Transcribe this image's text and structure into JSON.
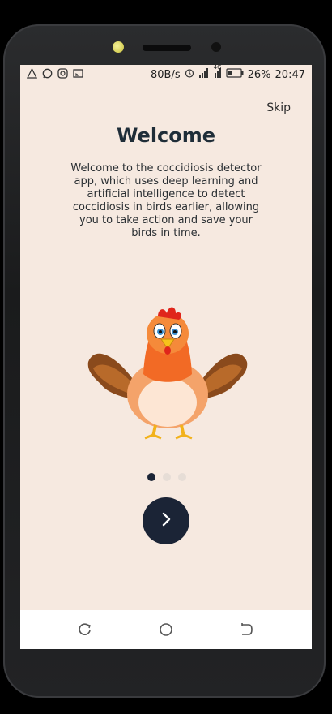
{
  "statusbar": {
    "speed": "80B/s",
    "battery": "26%",
    "time": "20:47",
    "network": "4G",
    "icons": [
      "alert-triangle-icon",
      "whatsapp-icon",
      "instagram-icon",
      "cast-icon",
      "alarm-icon",
      "signal-icon",
      "battery-icon"
    ]
  },
  "onboarding": {
    "skip_label": "Skip",
    "title": "Welcome",
    "description": "Welcome to the coccidiosis detector app, which uses deep learning and artificial intelligence to detect coccidiosis in birds earlier, allowing you to take action and save your birds in time.",
    "page_indicator": {
      "count": 3,
      "active_index": 0
    },
    "next_icon": "chevron-right-icon"
  },
  "colors": {
    "background": "#f6e9e0",
    "accent": "#1b2436",
    "inactive_dot": "#e6ddd6"
  },
  "navbar": {
    "icons": [
      "recent-apps-icon",
      "home-icon",
      "back-icon"
    ]
  }
}
